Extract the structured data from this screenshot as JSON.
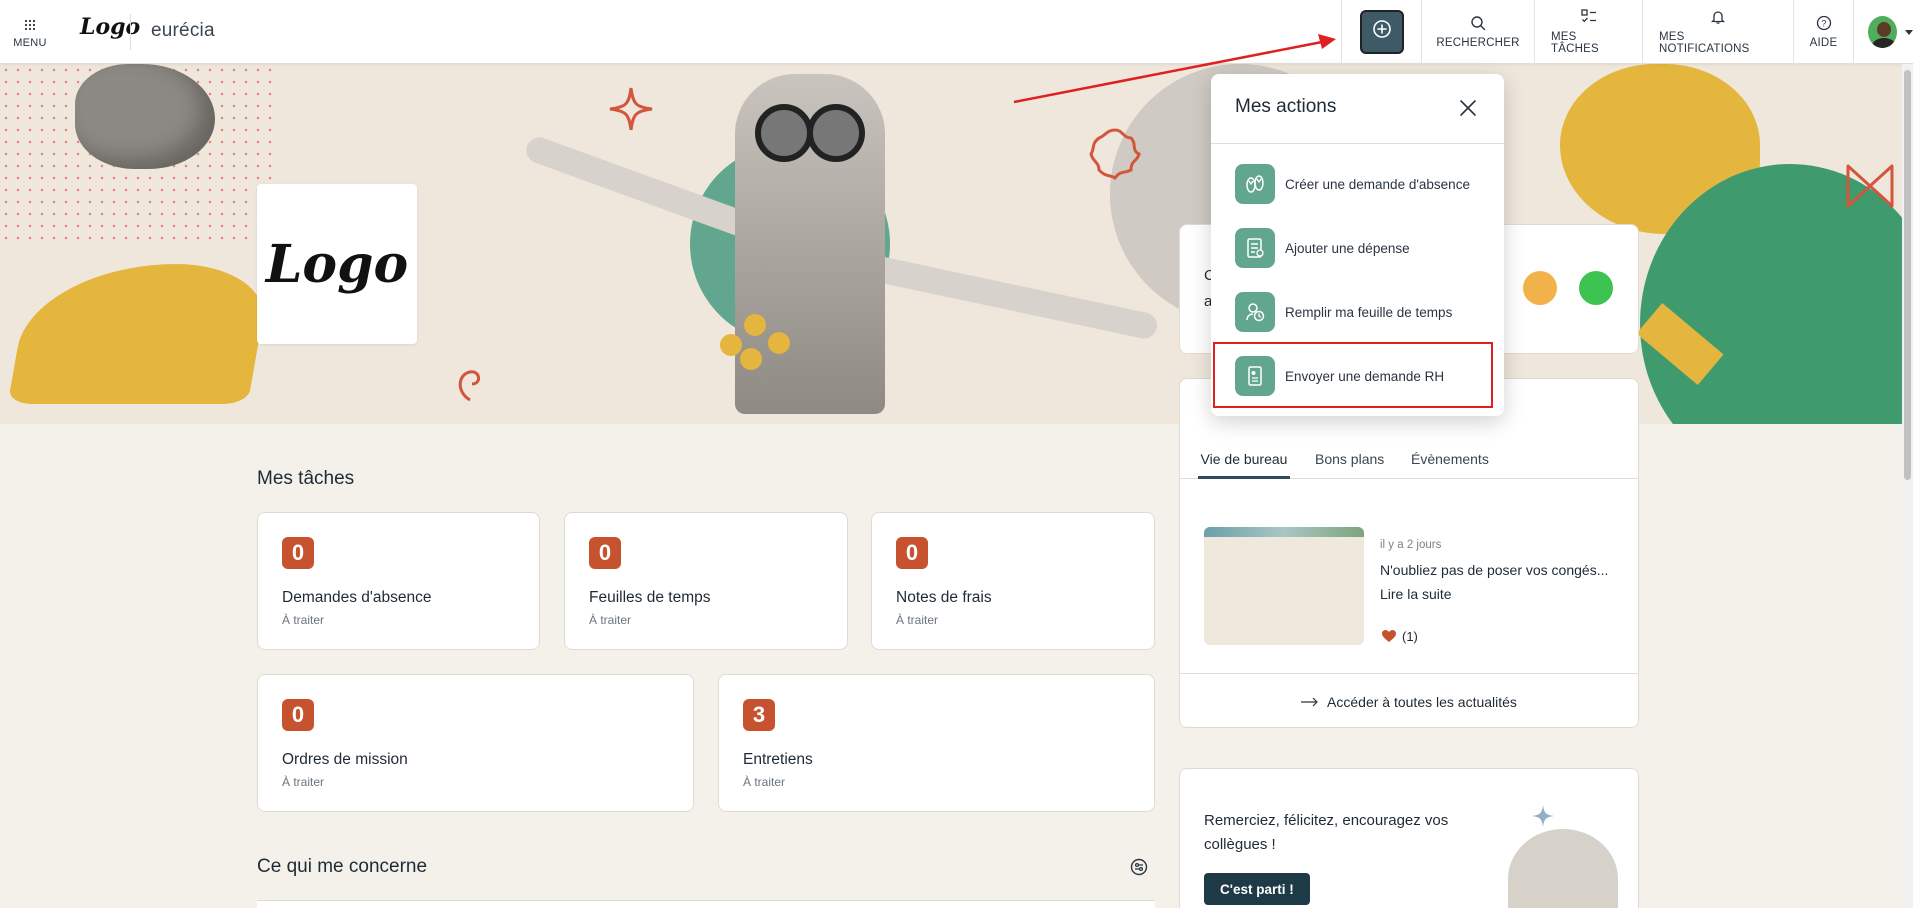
{
  "topbar": {
    "menu_label": "MENU",
    "brand_logo": "Logo",
    "brand_name": "eurécia",
    "nav": {
      "search": "RECHERCHER",
      "tasks": "MES TÂCHES",
      "notifications": "MES NOTIFICATIONS",
      "help": "AIDE"
    }
  },
  "hero": {
    "logo_text": "Logo"
  },
  "tasks_section": {
    "title": "Mes tâches",
    "cards": [
      {
        "count": "0",
        "title": "Demandes d'absence",
        "status": "À traiter"
      },
      {
        "count": "0",
        "title": "Feuilles de temps",
        "status": "À traiter"
      },
      {
        "count": "0",
        "title": "Notes de frais",
        "status": "À traiter"
      },
      {
        "count": "0",
        "title": "Ordres de mission",
        "status": "À traiter"
      },
      {
        "count": "3",
        "title": "Entretiens",
        "status": "À traiter"
      }
    ]
  },
  "concern_section": {
    "title": "Ce qui me concerne"
  },
  "mood_card": {
    "line1": "C",
    "line2": "a"
  },
  "news": {
    "tabs": [
      "Vie de bureau",
      "Bons plans",
      "Évènements"
    ],
    "date": "il y a 2 jours",
    "title": "N'oubliez pas de poser vos congés...",
    "link": "Lire la suite",
    "likes": "(1)",
    "footer": "Accéder à toutes les actualités"
  },
  "kudos": {
    "text": "Remerciez, félicitez, encouragez vos collègues !",
    "button": "C'est parti !"
  },
  "actions_dropdown": {
    "title": "Mes actions",
    "items": [
      {
        "label": "Créer une demande d'absence",
        "icon": "flip-flops-icon"
      },
      {
        "label": "Ajouter une dépense",
        "icon": "receipt-icon"
      },
      {
        "label": "Remplir ma feuille de temps",
        "icon": "timesheet-icon"
      },
      {
        "label": "Envoyer une demande RH",
        "icon": "hr-request-icon"
      }
    ]
  },
  "colors": {
    "accent": "#3d5a66",
    "badge": "#c6522f",
    "action_icon_bg": "#63a690",
    "annotation": "#e02020"
  }
}
